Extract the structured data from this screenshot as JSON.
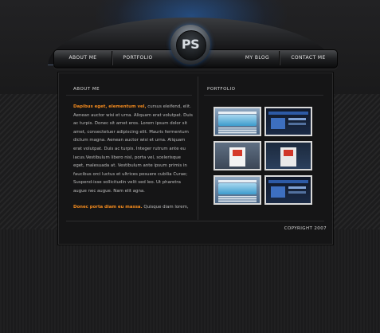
{
  "nav": {
    "about": "ABOUT ME",
    "portfolio": "PORTFOLIO",
    "blog": "MY BLOG",
    "contact": "CONTACT ME"
  },
  "logo": {
    "text": "PS"
  },
  "about_section": {
    "title": "ABOUT ME",
    "p1_highlight": "Dapibus eget, elementum vel,",
    "p1_body": " cursus eleifend, elit. Aenean auctor wisi et urna. Aliquam erat volutpat. Duis ac turpis. Donec sit amet eros. Lorem ipsum dolor sit amet, consectetuer adipiscing elit. Mauris fermentum dictum magna. Aenean auctor wisi et urna. Aliquam erat volutpat. Duis ac turpis. Integer rutrum ante eu lacus.Vestibulum libero nisl, porta vel, scelerisque eget, malesuada at. Vestibulum ante ipsum primis in faucibus orci luctus et ultrices posuere cubilia Curae; Suspend-isse sollicitudin velit sed leo. Ut pharetra augue nec augue. Nam elit agna.",
    "p2_highlight": "Donec porta diam eu massa.",
    "p2_body": " Quisque diam lorem,"
  },
  "portfolio_section": {
    "title": "PORTFOLIO",
    "thumbnails": [
      "portfolio-thumb-1",
      "portfolio-thumb-2",
      "portfolio-thumb-3",
      "portfolio-thumb-4",
      "portfolio-thumb-5",
      "portfolio-thumb-6"
    ]
  },
  "footer": {
    "copyright": "COPYRIGHT 2007"
  },
  "colors": {
    "accent": "#f28a1e",
    "glow": "#286ec8",
    "background": "#1b1b1c"
  }
}
